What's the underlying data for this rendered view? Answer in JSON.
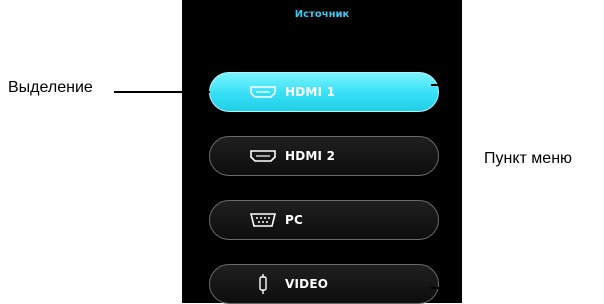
{
  "osd": {
    "title": "Источник",
    "items": [
      {
        "label": "HDMI 1",
        "icon": "hdmi-icon",
        "selected": true
      },
      {
        "label": "HDMI 2",
        "icon": "hdmi-icon",
        "selected": false
      },
      {
        "label": "PC",
        "icon": "vga-connector-icon",
        "selected": false
      },
      {
        "label": "VIDEO",
        "icon": "composite-connector-icon",
        "selected": false
      }
    ]
  },
  "callouts": {
    "highlight_label": "Выделение",
    "menu_item_label": "Пункт меню"
  },
  "colors": {
    "panel_background": "#000000",
    "title_text": "#39c9f0",
    "selected_item": "#36dff5",
    "item_text": "#ffffff"
  }
}
